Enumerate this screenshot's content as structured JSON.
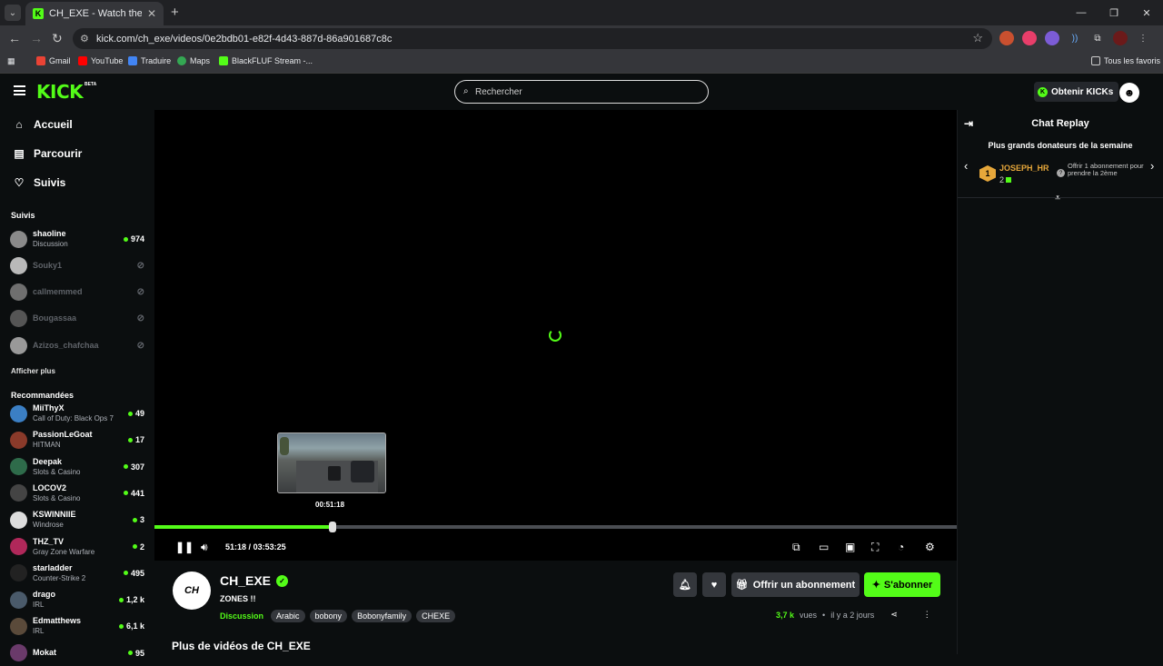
{
  "browser": {
    "tab_title": "CH_EXE - Watch the VOD on Kick",
    "url": "kick.com/ch_exe/videos/0e2bdb01-e82f-4d43-887d-86a901687c8c",
    "bookmarks": [
      "Gmail",
      "YouTube",
      "Traduire",
      "Maps",
      "BlackFLUF Stream -..."
    ],
    "all_bookmarks": "Tous les favoris"
  },
  "header": {
    "logo": "KICK",
    "beta": "BETA",
    "search_placeholder": "Rechercher",
    "kicks_button": "Obtenir KICKs"
  },
  "sidebar": {
    "nav": [
      "Accueil",
      "Parcourir",
      "Suivis"
    ],
    "following_title": "Suivis",
    "following": [
      {
        "name": "shaoline",
        "category": "Discussion",
        "viewers": "974",
        "live": true,
        "color": "#8a8a8a"
      },
      {
        "name": "Souky1",
        "category": "",
        "viewers": "",
        "live": false,
        "color": "#b9b9b9"
      },
      {
        "name": "callmemmed",
        "category": "",
        "viewers": "",
        "live": false,
        "color": "#6f6f6f"
      },
      {
        "name": "Bougassaa",
        "category": "",
        "viewers": "",
        "live": false,
        "color": "#555"
      },
      {
        "name": "Azizos_chafchaa",
        "category": "",
        "viewers": "",
        "live": false,
        "color": "#999"
      }
    ],
    "show_more": "Afficher plus",
    "recommended_title": "Recommandées",
    "recommended": [
      {
        "name": "MiiThyX",
        "category": "Call of Duty: Black Ops 7",
        "viewers": "49",
        "color": "#3b7fc4"
      },
      {
        "name": "PassionLeGoat",
        "category": "HITMAN",
        "viewers": "17",
        "color": "#8a3a2a"
      },
      {
        "name": "Deepak",
        "category": "Slots & Casino",
        "viewers": "307",
        "color": "#2e6b4a"
      },
      {
        "name": "LOCOV2",
        "category": "Slots & Casino",
        "viewers": "441",
        "color": "#444"
      },
      {
        "name": "KSWINNIIE",
        "category": "Windrose",
        "viewers": "3",
        "color": "#ddd"
      },
      {
        "name": "THZ_TV",
        "category": "Gray Zone Warfare",
        "viewers": "2",
        "color": "#b0285a"
      },
      {
        "name": "starladder",
        "category": "Counter-Strike 2",
        "viewers": "495",
        "color": "#222"
      },
      {
        "name": "drago",
        "category": "IRL",
        "viewers": "1,2 k",
        "color": "#4a5a6a"
      },
      {
        "name": "Edmatthews",
        "category": "IRL",
        "viewers": "6,1 k",
        "color": "#5a4a3a"
      },
      {
        "name": "Mokat",
        "category": "",
        "viewers": "95",
        "color": "#6a3a6a"
      }
    ]
  },
  "player": {
    "hover_time": "00:51:18",
    "current_time": "51:18",
    "separator": "/",
    "duration": "03:53:25",
    "progress": 0.222
  },
  "chat": {
    "title": "Chat Replay",
    "donors_title": "Plus grands donateurs de la semaine",
    "top_donor": {
      "rank": "1",
      "name": "JOSEPH_HR",
      "count": "2"
    },
    "offer_text": "Offrir 1 abonnement pour prendre la 2ème"
  },
  "stream": {
    "channel": "CH_EXE",
    "avatar_text": "CH",
    "title": "ZONES !!",
    "category": "Discussion",
    "tags": [
      "Arabic",
      "bobony",
      "Bobonyfamily",
      "CHEXE"
    ],
    "gift_button": "Offrir un abonnement",
    "subscribe_button": "S'abonner",
    "views_value": "3,7 k",
    "views_label": "vues",
    "bullet": "•",
    "age": "il y a 2 jours",
    "more_videos": "Plus de vidéos de CH_EXE"
  },
  "colors": {
    "accent": "#53fc18",
    "background": "#0b0e0f",
    "donor": "#e6a73a"
  }
}
